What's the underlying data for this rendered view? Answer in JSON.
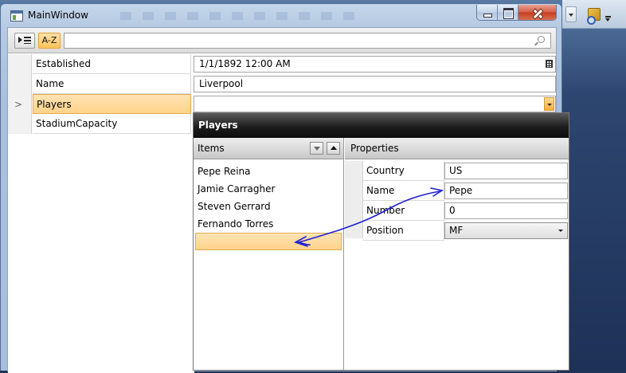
{
  "window": {
    "title": "MainWindow"
  },
  "toolbar": {
    "categorized_icon": "categorized-icon",
    "alphabetical_label": "A-Z",
    "search_value": "",
    "search_icon": "search-icon"
  },
  "properties": [
    {
      "name": "Established",
      "value": "1/1/1892 12:00 AM",
      "editor": "datetime"
    },
    {
      "name": "Name",
      "value": "Liverpool",
      "editor": "text"
    },
    {
      "name": "Players",
      "value": "",
      "editor": "collection",
      "marker": ">"
    },
    {
      "name": "StadiumCapacity",
      "value": "",
      "editor": "none"
    }
  ],
  "popup": {
    "title": "Players",
    "items_header": "Items",
    "items": [
      "Pepe Reina",
      "Jamie Carragher",
      "Steven Gerrard",
      "Fernando Torres",
      ""
    ],
    "selected_item_index": 4,
    "properties_header": "Properties",
    "properties": [
      {
        "name": "Country",
        "value": "US"
      },
      {
        "name": "Name",
        "value": "Pepe"
      },
      {
        "name": "Number",
        "value": "0"
      },
      {
        "name": "Position",
        "value": "MF"
      }
    ]
  },
  "colors": {
    "selection": "#ffd38a",
    "annotation": "#1f1fd6",
    "popup_header": "#1e1e1e"
  }
}
